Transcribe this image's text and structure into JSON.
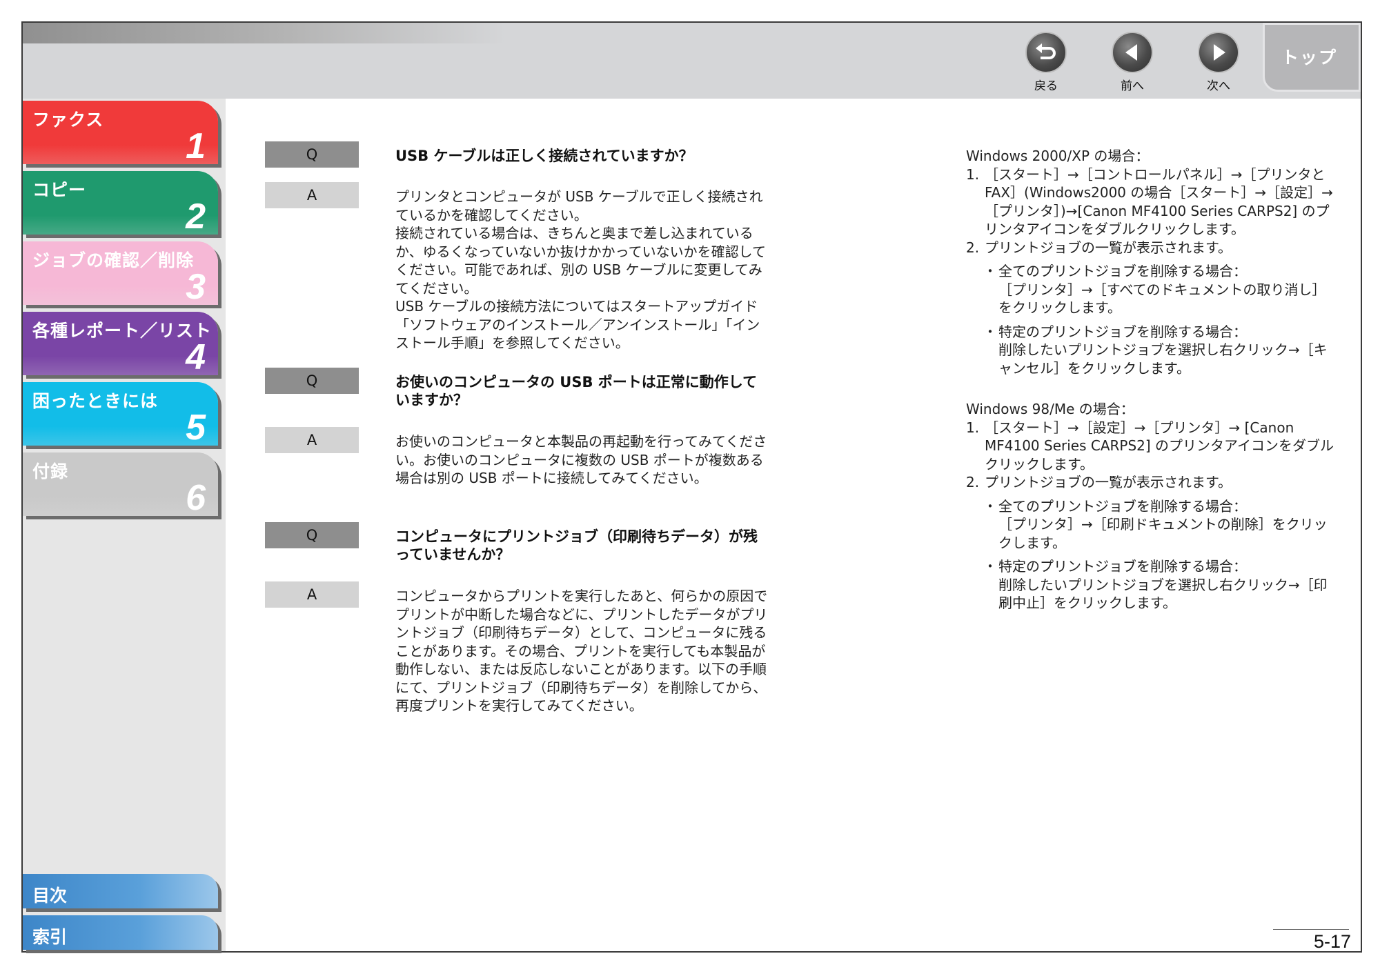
{
  "nav": {
    "back_label": "戻る",
    "prev_label": "前へ",
    "next_label": "次へ",
    "top_label": "トップ"
  },
  "chapters": [
    {
      "title": "ファクス",
      "number": "1",
      "color": "#f03a3a"
    },
    {
      "title": "コピー",
      "number": "2",
      "color": "#1f9a6e"
    },
    {
      "title": "ジョブの確認／削除",
      "number": "3",
      "color": "#f6b8d6"
    },
    {
      "title": "各種レポート／リスト",
      "number": "4",
      "color": "#7a45a6"
    },
    {
      "title": "困ったときには",
      "number": "5",
      "color": "#12bde8"
    },
    {
      "title": "付録",
      "number": "6",
      "color": "#c9c9c9"
    }
  ],
  "bottom_tabs": {
    "contents": "目次",
    "index": "索引"
  },
  "qa": [
    {
      "q_label": "Q",
      "question": "USB ケーブルは正しく接続されていますか？",
      "a_label": "A",
      "answer": "プリンタとコンピュータが USB ケーブルで正しく接続されているかを確認してください。\n接続されている場合は、きちんと奥まで差し込まれているか、ゆるくなっていないか抜けかかっていないかを確認してください。可能であれば、別の USB ケーブルに変更してみてください。\nUSB ケーブルの接続方法についてはスタートアップガイド「ソフトウェアのインストール／アンインストール」「インストール手順」を参照してください。"
    },
    {
      "q_label": "Q",
      "question": "お使いのコンピュータの USB ポートは正常に動作していますか？",
      "a_label": "A",
      "answer": "お使いのコンピュータと本製品の再起動を行ってみてください。お使いのコンピュータに複数の USB ポートが複数ある場合は別の USB ポートに接続してみてください。"
    },
    {
      "q_label": "Q",
      "question": "コンピュータにプリントジョブ（印刷待ちデータ）が残っていませんか？",
      "a_label": "A",
      "answer": "コンピュータからプリントを実行したあと、何らかの原因でプリントが中断した場合などに、プリントしたデータがプリントジョブ（印刷待ちデータ）として、コンピュータに残ることがあります。その場合、プリントを実行しても本製品が動作しない、または反応しないことがあります。以下の手順にて、プリントジョブ（印刷待ちデータ）を削除してから、再度プリントを実行してみてください。"
    }
  ],
  "right": {
    "win2000": {
      "heading": "Windows 2000/XP の場合：",
      "step1_num": "1.",
      "step1": "［スタート］→［コントロールパネル］→［プリンタとFAX］(Windows2000 の場合［スタート］→［設定］→［プリンタ］)→[Canon MF4100 Series CARPS2] のプリンタアイコンをダブルクリックします。",
      "step2_num": "2.",
      "step2": "プリントジョブの一覧が表示されます。",
      "bullet1": "全てのプリントジョブを削除する場合：\n［プリンタ］→［すべてのドキュメントの取り消し］をクリックします。",
      "bullet2": "特定のプリントジョブを削除する場合：\n削除したいプリントジョブを選択し右クリック→［キャンセル］をクリックします。"
    },
    "win98": {
      "heading": "Windows 98/Me の場合：",
      "step1_num": "1.",
      "step1": "［スタート］→［設定］→［プリンタ］→ [Canon MF4100 Series CARPS2] のプリンタアイコンをダブルクリックします。",
      "step2_num": "2.",
      "step2": "プリントジョブの一覧が表示されます。",
      "bullet1": "全てのプリントジョブを削除する場合：\n［プリンタ］→［印刷ドキュメントの削除］をクリックします。",
      "bullet2": "特定のプリントジョブを削除する場合：\n削除したいプリントジョブを選択し右クリック→［印刷中止］をクリックします。"
    },
    "bullet_mark": "・"
  },
  "page_number": "5-17"
}
